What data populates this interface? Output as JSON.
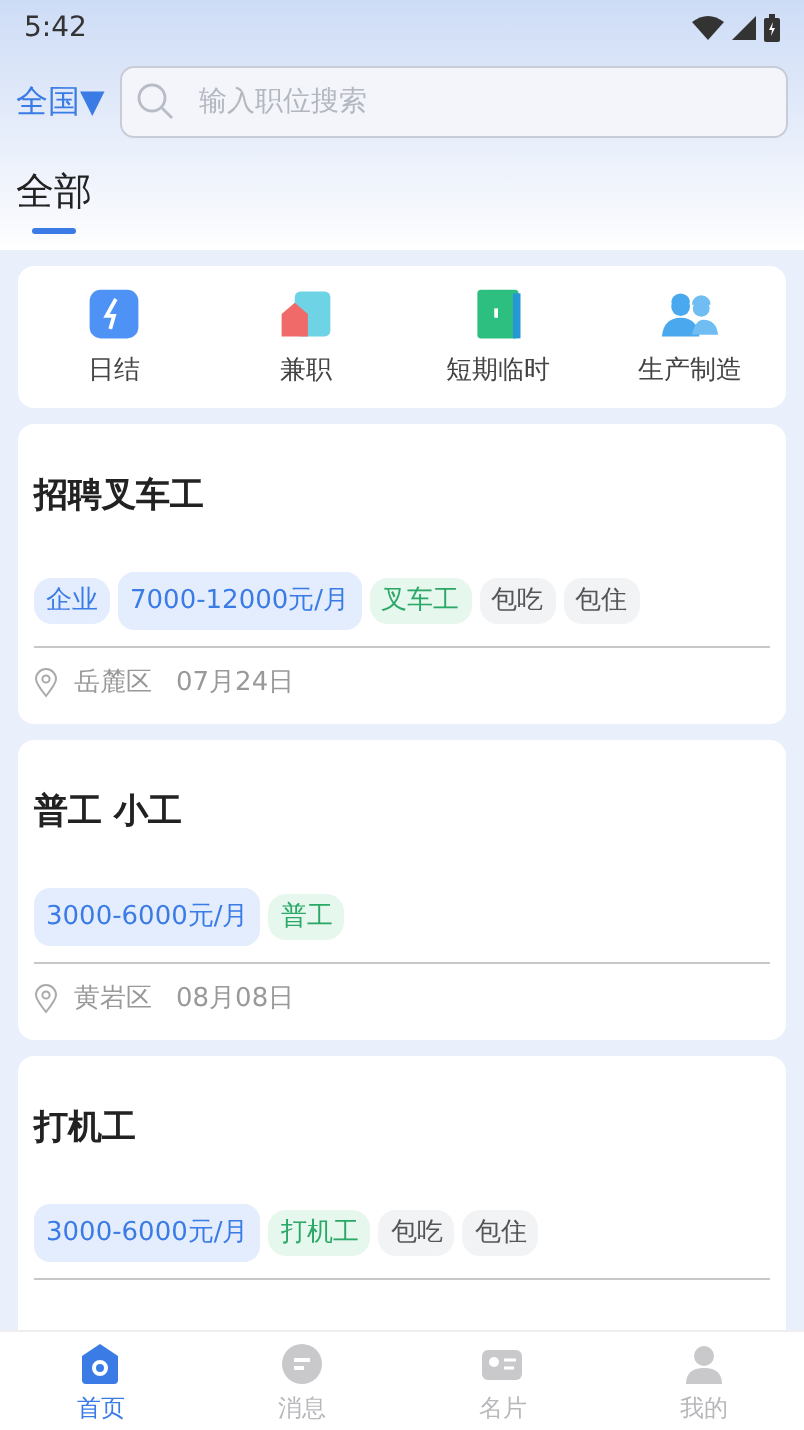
{
  "status_bar": {
    "time": "5:42"
  },
  "header": {
    "region": "全国",
    "region_caret": "▼",
    "search": {
      "placeholder": "输入职位搜索"
    }
  },
  "tabs": [
    {
      "label": "全部",
      "selected": true
    }
  ],
  "categories": [
    {
      "label": "日结",
      "kind": "bolt"
    },
    {
      "label": "兼职",
      "kind": "house"
    },
    {
      "label": "短期临时",
      "kind": "door"
    },
    {
      "label": "生产制造",
      "kind": "workers"
    }
  ],
  "jobs": [
    {
      "title": "招聘叉车工",
      "tags": [
        {
          "text": "企业",
          "kind": "company"
        },
        {
          "text": "7000-12000元/月",
          "kind": "salary"
        },
        {
          "text": "叉车工",
          "kind": "type"
        },
        {
          "text": "包吃",
          "kind": "benefit"
        },
        {
          "text": "包住",
          "kind": "benefit"
        }
      ],
      "location": "岳麓区",
      "date": "07月24日"
    },
    {
      "title": "普工 小工",
      "tags": [
        {
          "text": "3000-6000元/月",
          "kind": "salary"
        },
        {
          "text": "普工",
          "kind": "type"
        }
      ],
      "location": "黄岩区",
      "date": "08月08日"
    },
    {
      "title": "打机工",
      "tags": [
        {
          "text": "3000-6000元/月",
          "kind": "salary"
        },
        {
          "text": "打机工",
          "kind": "type"
        },
        {
          "text": "包吃",
          "kind": "benefit"
        },
        {
          "text": "包住",
          "kind": "benefit"
        }
      ]
    }
  ],
  "bottom_nav": [
    {
      "label": "首页",
      "kind": "home",
      "selected": true
    },
    {
      "label": "消息",
      "kind": "message",
      "selected": false
    },
    {
      "label": "名片",
      "kind": "card",
      "selected": false
    },
    {
      "label": "我的",
      "kind": "person",
      "selected": false
    }
  ]
}
